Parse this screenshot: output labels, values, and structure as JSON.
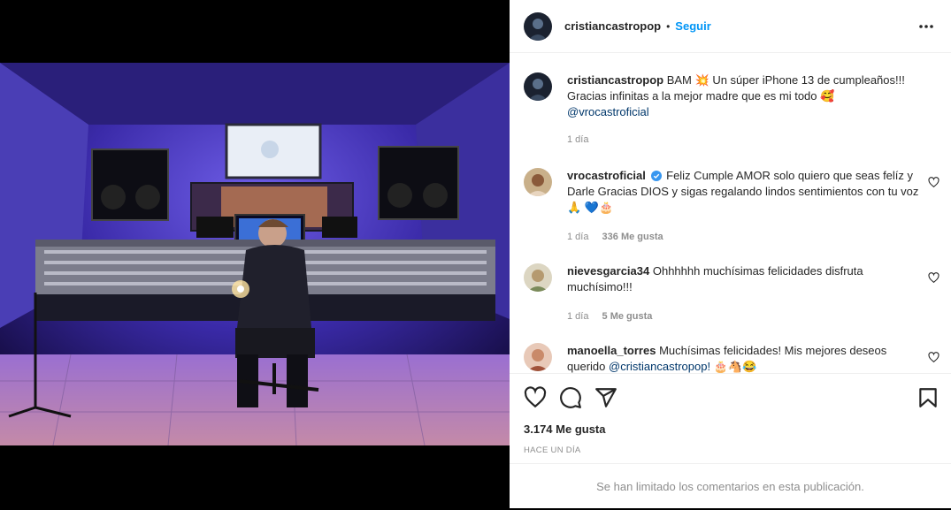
{
  "post": {
    "username": "cristiancastropop",
    "follow_label": "Seguir",
    "separator": "•"
  },
  "caption": {
    "username": "cristiancastropop",
    "text_1": "BAM",
    "text_2": "Un súper iPhone 13 de cumpleaños!!! Gracias infinitas a la mejor madre que es mi todo",
    "mention": "@vrocastroficial",
    "age": "1 día"
  },
  "comments": [
    {
      "username": "vrocastroficial",
      "text": "Feliz Cumple AMOR solo quiero que seas felíz y Darle Gracias DIOS y sigas regalando lindos sentimientos con tu voz",
      "emoji": "🙏 💙🎂",
      "age": "1 día",
      "likes": "336 Me gusta"
    },
    {
      "username": "nievesgarcia34",
      "text": "Ohhhhhh muchísimas felicidades disfruta muchísimo!!!",
      "age": "1 día",
      "likes": "5 Me gusta"
    },
    {
      "username": "manoella_torres",
      "text": "Muchísimas felicidades! Mis mejores deseos querido",
      "mention": "@cristiancastropop!",
      "emoji": "🎂🐴😂"
    }
  ],
  "footer": {
    "likes": "3.174 Me gusta",
    "timestamp": "HACE UN DÍA",
    "limited": "Se han limitado los comentarios en esta publicación."
  },
  "colors": {
    "accent": "#0095f6",
    "mention": "#00376b",
    "muted": "#8e8e8e"
  }
}
